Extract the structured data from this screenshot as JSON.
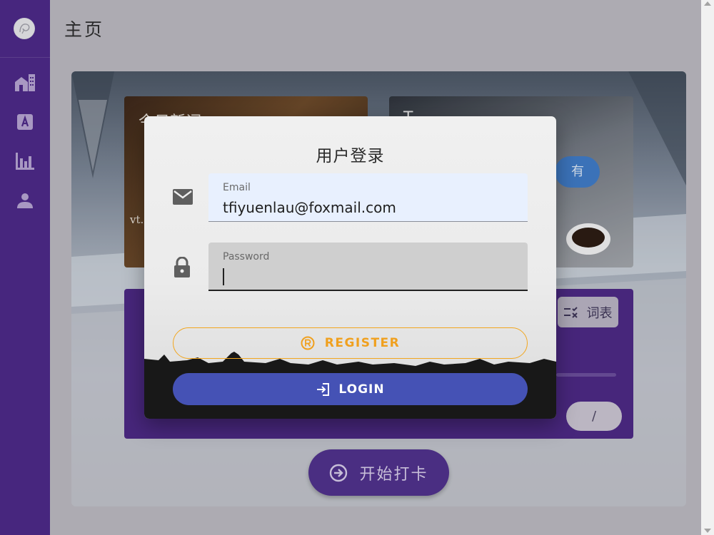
{
  "header": {
    "title": "主页"
  },
  "sidebar": {
    "items": [
      {
        "name": "home",
        "icon": "home-icon"
      },
      {
        "name": "words",
        "icon": "letter-a-icon"
      },
      {
        "name": "stats",
        "icon": "bar-chart-icon"
      },
      {
        "name": "profile",
        "icon": "person-icon"
      }
    ]
  },
  "background": {
    "news_card": {
      "title": "今日新词",
      "text": "vt."
    },
    "card2": {
      "title": "T",
      "chip_label": "有"
    },
    "wordlist_button": {
      "label": "词表",
      "icon": "checklist-icon"
    },
    "fraction_label": "/",
    "checkin_button": {
      "label": "开始打卡",
      "icon": "arrow-circle-right-icon"
    }
  },
  "login_dialog": {
    "title": "用户登录",
    "email": {
      "label": "Email",
      "value": "tfiyuenlau@foxmail.com",
      "icon": "mail-icon"
    },
    "password": {
      "label": "Password",
      "value": "",
      "icon": "lock-icon"
    },
    "register_button": {
      "label": "REGISTER",
      "icon": "registered-icon"
    },
    "login_button": {
      "label": "LOGIN",
      "icon": "login-icon"
    }
  },
  "colors": {
    "sidebar": "#4a2785",
    "accent_purple": "#4e2f89",
    "login_blue": "#4552b5",
    "register_orange": "#f0a01e",
    "email_field_bg": "#e8f0fe"
  }
}
